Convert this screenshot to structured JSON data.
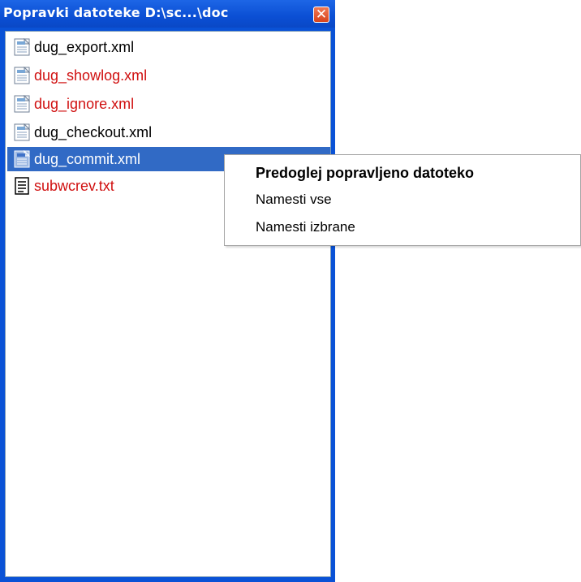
{
  "window": {
    "title": "Popravki datoteke  D:\\sc...\\doc",
    "close_icon": "close-icon"
  },
  "files": [
    {
      "name": "dug_export.xml",
      "color": "#000000",
      "icon": "xml-file-icon"
    },
    {
      "name": "dug_showlog.xml",
      "color": "#d01010",
      "icon": "xml-file-icon"
    },
    {
      "name": "dug_ignore.xml",
      "color": "#d01010",
      "icon": "xml-file-icon"
    },
    {
      "name": "dug_checkout.xml",
      "color": "#000000",
      "icon": "xml-file-icon"
    },
    {
      "name": "dug_commit.xml",
      "color": "#ffffff",
      "icon": "xml-file-icon",
      "selected": true
    },
    {
      "name": "subwcrev.txt",
      "color": "#d01010",
      "icon": "text-file-icon"
    }
  ],
  "context_menu": {
    "items": [
      {
        "label": "Predoglej popravljeno datoteko",
        "default": true
      },
      {
        "label": "Namesti vse"
      },
      {
        "label": "Namesti izbrane"
      }
    ]
  },
  "colors": {
    "titlebar": "#0a52d6",
    "selection": "#316ac5",
    "modified_text": "#d01010"
  }
}
